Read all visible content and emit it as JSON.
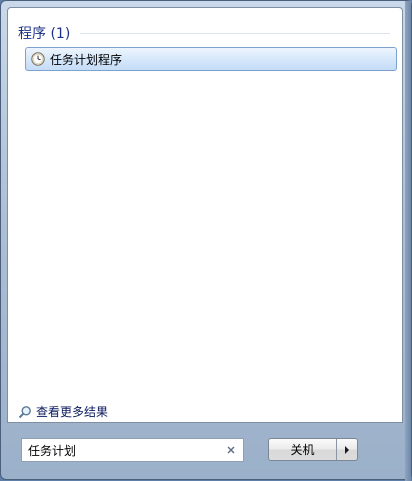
{
  "results": {
    "group_header": "程序 (1)",
    "items": [
      {
        "label": "任务计划程序",
        "icon": "clock-icon"
      }
    ],
    "more_results": "查看更多结果"
  },
  "search": {
    "value": "任务计划",
    "clear_icon": "close-icon"
  },
  "shutdown": {
    "label": "关机",
    "arrow_icon": "chevron-right-icon"
  }
}
